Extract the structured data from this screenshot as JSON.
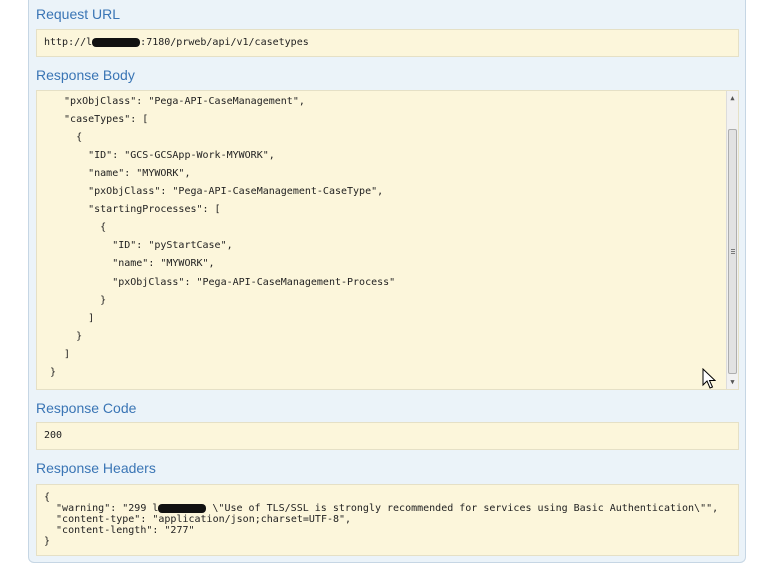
{
  "request_url": {
    "title": "Request URL",
    "url_prefix": "http://l",
    "url_suffix": ":7180/prweb/api/v1/casetypes"
  },
  "response_body": {
    "title": "Response Body",
    "lines": [
      "  \"pxObjClass\": \"Pega-API-CaseManagement\",",
      "  \"caseTypes\": [",
      "    {",
      "      \"ID\": \"GCS-GCSApp-Work-MYWORK\",",
      "      \"name\": \"MYWORK\",",
      "      \"pxObjClass\": \"Pega-API-CaseManagement-CaseType\",",
      "      \"startingProcesses\": [",
      "        {",
      "          \"ID\": \"pyStartCase\",",
      "          \"name\": \"MYWORK\",",
      "          \"pxObjClass\": \"Pega-API-CaseManagement-Process\"",
      "        }",
      "      ]",
      "    }",
      "  ]",
      "}"
    ],
    "scroll_up_icon": "triangle-up",
    "scroll_down_icon": "triangle-down"
  },
  "response_code": {
    "title": "Response Code",
    "value": "200"
  },
  "response_headers": {
    "title": "Response Headers",
    "line1": "{",
    "line2_prefix": "  \"warning\": \"299 l",
    "line2_suffix": " \\\"Use of TLS/SSL is strongly recommended for services using Basic Authentication\\\"\",",
    "line3": "  \"content-type\": \"application/json;charset=UTF-8\",",
    "line4": "  \"content-length\": \"277\"",
    "line5": "}"
  }
}
